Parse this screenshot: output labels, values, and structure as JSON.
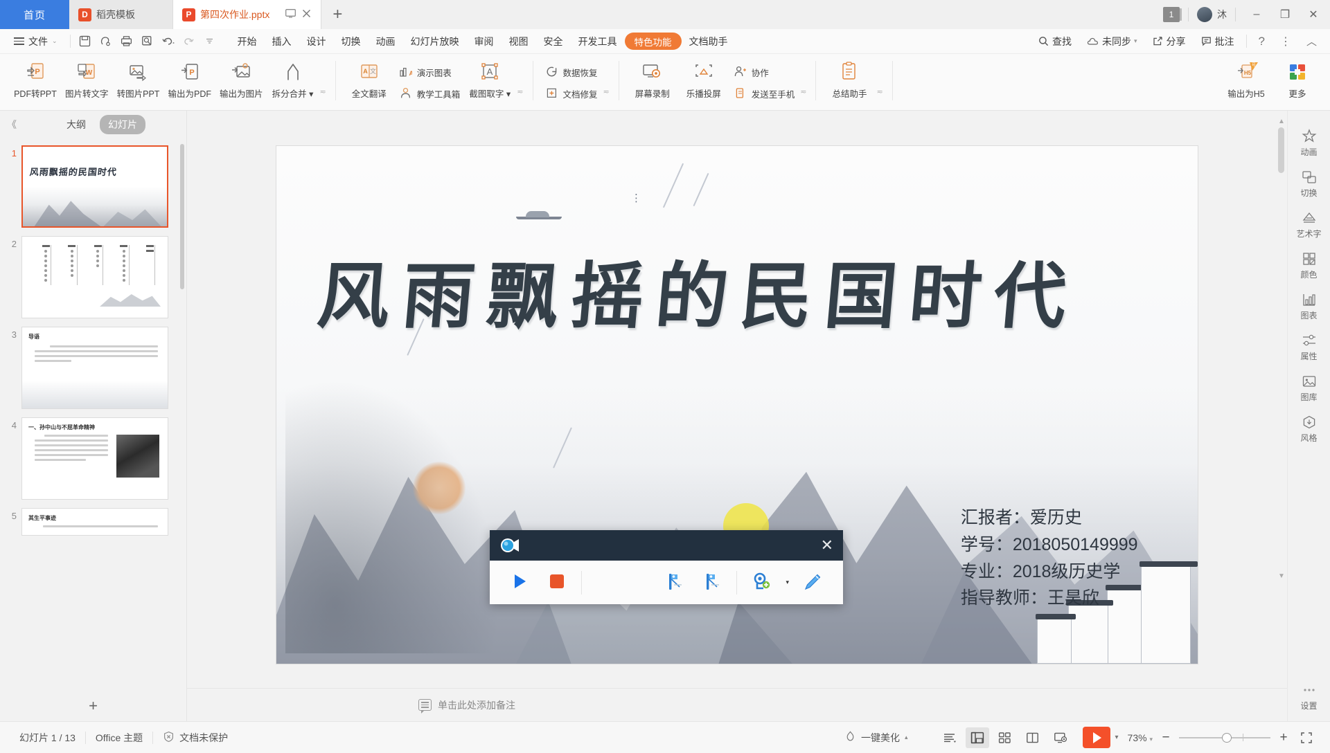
{
  "window": {
    "home_tab": "首页",
    "tabs": [
      {
        "title": "稻壳模板",
        "icon": "dock-template-icon",
        "active": false
      },
      {
        "title": "第四次作业.pptx",
        "icon": "wpp-file-icon",
        "active": true
      }
    ],
    "new_tab": "+",
    "notification_count": "1",
    "user_name": "沐",
    "minimize": "–",
    "restore": "❐",
    "close": "✕"
  },
  "menubar": {
    "file": "文件",
    "quick_access": [
      "save-icon",
      "touch-mode-icon",
      "print-icon",
      "print-preview-icon",
      "undo-icon",
      "redo-icon",
      "customize-qat-icon"
    ],
    "items": [
      "开始",
      "插入",
      "设计",
      "切换",
      "动画",
      "幻灯片放映",
      "审阅",
      "视图",
      "安全",
      "开发工具"
    ],
    "highlight_item": "特色功能",
    "after_items": [
      "文档助手"
    ],
    "search": "查找",
    "sync": "未同步",
    "share": "分享",
    "comment": "批注",
    "help": "?",
    "more": "⋮",
    "collapse": "︿"
  },
  "ribbon": {
    "groups": [
      {
        "buttons": [
          {
            "label": "PDF转PPT",
            "icon": "pdf-to-ppt-icon"
          },
          {
            "label": "图片转文字",
            "icon": "image-to-text-icon"
          },
          {
            "label": "转图片PPT",
            "icon": "to-image-ppt-icon"
          },
          {
            "label": "输出为PDF",
            "icon": "export-pdf-icon"
          },
          {
            "label": "输出为图片",
            "icon": "export-image-icon"
          },
          {
            "label": "拆分合并",
            "icon": "split-merge-icon",
            "dropdown": true
          }
        ]
      },
      {
        "buttons": [
          {
            "label": "全文翻译",
            "icon": "translate-icon"
          }
        ],
        "small": [
          {
            "label": "演示图表",
            "icon": "chart-icon"
          },
          {
            "label": "教学工具箱",
            "icon": "teaching-toolbox-icon"
          }
        ],
        "buttons2": [
          {
            "label": "截图取字",
            "icon": "screenshot-ocr-icon",
            "dropdown": true
          }
        ]
      },
      {
        "small": [
          {
            "label": "数据恢复",
            "icon": "data-recovery-icon"
          },
          {
            "label": "文档修复",
            "icon": "doc-repair-icon"
          }
        ]
      },
      {
        "buttons": [
          {
            "label": "屏幕录制",
            "icon": "screen-record-icon"
          },
          {
            "label": "乐播投屏",
            "icon": "cast-screen-icon"
          }
        ],
        "small": [
          {
            "label": "协作",
            "icon": "collaborate-icon"
          },
          {
            "label": "发送至手机",
            "icon": "send-to-phone-icon"
          }
        ]
      },
      {
        "buttons": [
          {
            "label": "总结助手",
            "icon": "summary-assistant-icon"
          }
        ]
      },
      {
        "buttons": [
          {
            "label": "输出为H5",
            "icon": "export-h5-icon"
          },
          {
            "label": "更多",
            "icon": "more-apps-icon"
          }
        ]
      }
    ]
  },
  "slide_panel": {
    "collapse": "《",
    "tab_outline": "大纲",
    "tab_slides": "幻灯片",
    "add_slide": "+",
    "slides": [
      {
        "num": "1",
        "type": "title",
        "title": "风雨飘摇的民国时代",
        "active": true
      },
      {
        "num": "2",
        "type": "vertical-text",
        "active": false
      },
      {
        "num": "3",
        "type": "text",
        "heading": "导语",
        "active": false
      },
      {
        "num": "4",
        "type": "text-photo",
        "heading": "一、孙中山与不屈革命精神",
        "active": false
      },
      {
        "num": "5",
        "type": "text",
        "heading": "其生平事迹",
        "active": false
      }
    ]
  },
  "slide": {
    "title": "风雨飘摇的民国时代",
    "info_lines": [
      "汇报者：爱历史",
      "学号：2018050149999",
      "专业：2018级历史学",
      "指导教师：王昊欣"
    ]
  },
  "notes": {
    "placeholder": "单击此处添加备注",
    "icon": "notes-icon"
  },
  "right_rail": {
    "items": [
      {
        "label": "动画",
        "icon": "animation-icon"
      },
      {
        "label": "切换",
        "icon": "transition-icon"
      },
      {
        "label": "艺术字",
        "icon": "wordart-icon"
      },
      {
        "label": "颜色",
        "icon": "color-icon"
      },
      {
        "label": "图表",
        "icon": "chart-panel-icon"
      },
      {
        "label": "属性",
        "icon": "properties-icon"
      },
      {
        "label": "图库",
        "icon": "gallery-icon"
      },
      {
        "label": "风格",
        "icon": "style-icon"
      }
    ],
    "bottom": {
      "label": "设置",
      "icon": "settings-icon"
    }
  },
  "status_bar": {
    "slide_count": "幻灯片 1 / 13",
    "theme": "Office 主题",
    "protection": "文档未保护",
    "protection_icon": "shield-off-icon",
    "beautify": "一键美化",
    "beautify_icon": "beautify-icon",
    "view_buttons": [
      {
        "name": "outline-view",
        "selected": false
      },
      {
        "name": "normal-view",
        "selected": true
      },
      {
        "name": "slide-sorter-view",
        "selected": false
      },
      {
        "name": "reading-view",
        "selected": false
      },
      {
        "name": "presenter-view",
        "selected": false
      }
    ],
    "play": "播放",
    "zoom_level": "73%",
    "zoom_out": "−",
    "zoom_in": "+",
    "fit_window": "适应窗口"
  },
  "record_toolbar": {
    "logo_icon": "camera-record-icon",
    "close": "✕",
    "buttons": [
      {
        "name": "play-record-button",
        "icon": "play-triangle-icon"
      },
      {
        "name": "stop-record-button",
        "icon": "stop-square-icon"
      },
      {
        "name": "prev-marker-button",
        "icon": "marker-left-icon"
      },
      {
        "name": "next-marker-button",
        "icon": "marker-right-icon"
      },
      {
        "name": "add-webcam-button",
        "icon": "webcam-add-icon"
      },
      {
        "name": "pen-button",
        "icon": "pen-icon"
      }
    ],
    "dropdown_caret": "▾"
  },
  "colors": {
    "accent_blue": "#3a7de0",
    "accent_orange": "#f07a35",
    "play_red": "#f4502a",
    "rec_dark": "#22303f",
    "slide_ink": "#343f48"
  }
}
